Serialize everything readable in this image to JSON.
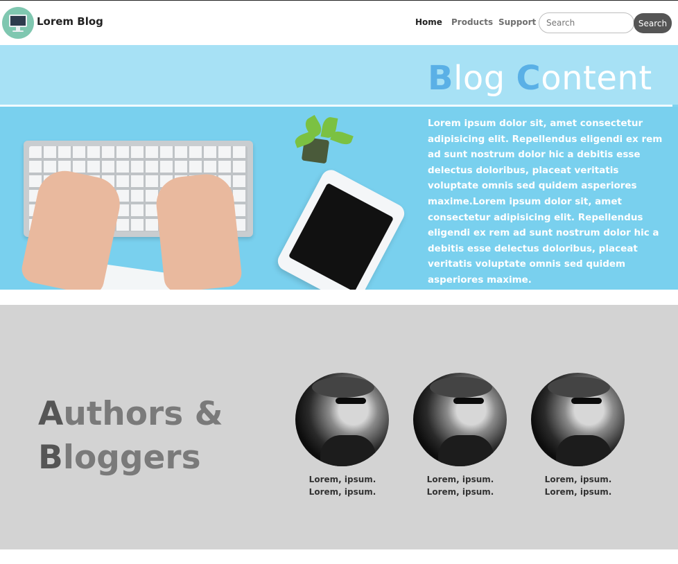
{
  "navbar": {
    "brand": "Lorem Blog",
    "links": [
      "Home",
      "Products",
      "Support"
    ],
    "active_link": "Home",
    "search_placeholder": "Search",
    "search_button": "Search"
  },
  "hero": {
    "title_cap1": "B",
    "title_rest1": "log ",
    "title_cap2": "C",
    "title_rest2": "ontent",
    "text": "Lorem ipsum dolor sit, amet consectetur adipisicing elit. Repellendus eligendi ex rem ad sunt nostrum dolor hic a debitis esse delectus doloribus, placeat veritatis voluptate omnis sed quidem asperiores maxime.Lorem ipsum dolor sit, amet consectetur adipisicing elit. Repellendus eligendi ex rem ad sunt nostrum dolor hic a debitis esse delectus doloribus, placeat veritatis voluptate omnis sed quidem asperiores maxime."
  },
  "authors": {
    "title_cap1": "A",
    "title_rest1": "uthors &",
    "title_cap2": "B",
    "title_rest2": "loggers",
    "cards": [
      {
        "line1": "Lorem, ipsum.",
        "line2": "Lorem, ipsum."
      },
      {
        "line1": "Lorem, ipsum.",
        "line2": "Lorem, ipsum."
      },
      {
        "line1": "Lorem, ipsum.",
        "line2": "Lorem, ipsum."
      }
    ]
  },
  "colors": {
    "accent": "#5ab0e6",
    "hero_bg": "#79d0ee",
    "authors_bg": "#d3d3d3",
    "button": "#555555"
  }
}
